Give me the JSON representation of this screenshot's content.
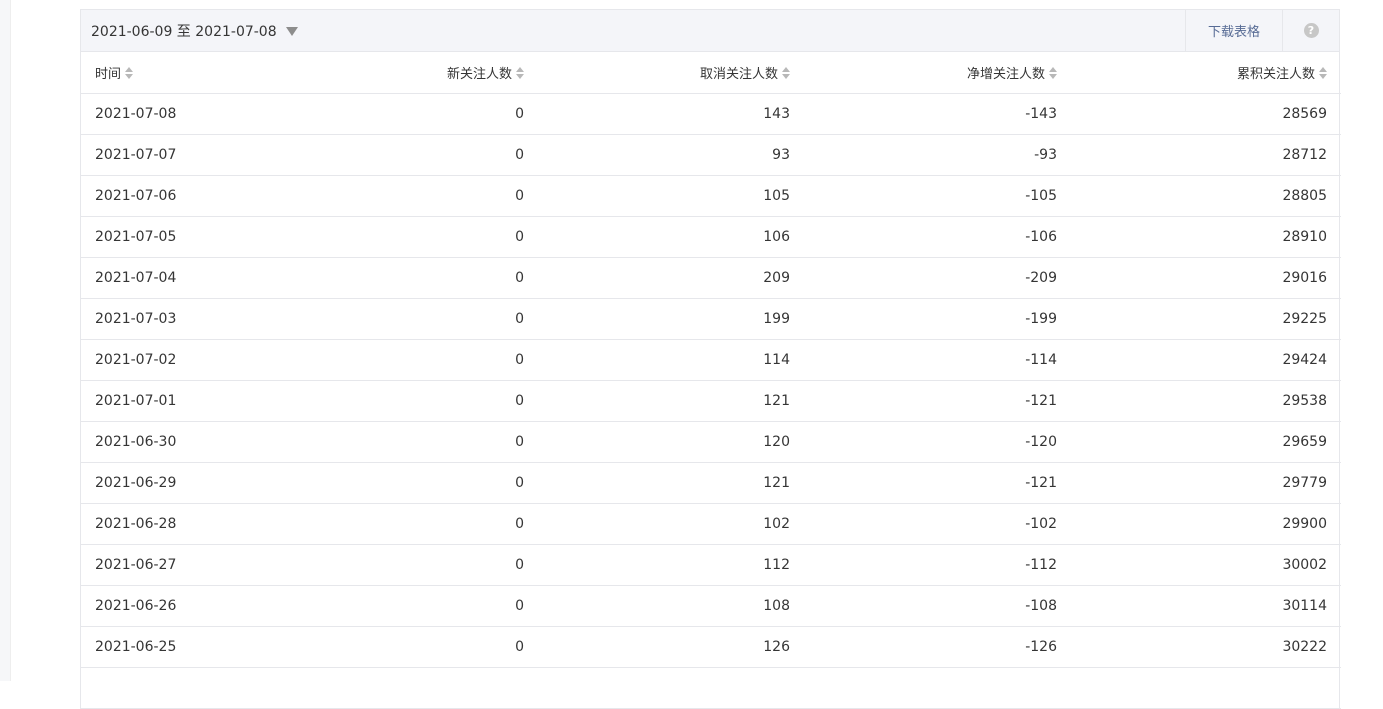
{
  "toolbar": {
    "date_range": "2021-06-09 至 2021-07-08",
    "download_label": "下载表格",
    "help_glyph": "?"
  },
  "table": {
    "headers": [
      "时间",
      "新关注人数",
      "取消关注人数",
      "净增关注人数",
      "累积关注人数"
    ],
    "rows": [
      [
        "2021-07-08",
        "0",
        "143",
        "-143",
        "28569"
      ],
      [
        "2021-07-07",
        "0",
        "93",
        "-93",
        "28712"
      ],
      [
        "2021-07-06",
        "0",
        "105",
        "-105",
        "28805"
      ],
      [
        "2021-07-05",
        "0",
        "106",
        "-106",
        "28910"
      ],
      [
        "2021-07-04",
        "0",
        "209",
        "-209",
        "29016"
      ],
      [
        "2021-07-03",
        "0",
        "199",
        "-199",
        "29225"
      ],
      [
        "2021-07-02",
        "0",
        "114",
        "-114",
        "29424"
      ],
      [
        "2021-07-01",
        "0",
        "121",
        "-121",
        "29538"
      ],
      [
        "2021-06-30",
        "0",
        "120",
        "-120",
        "29659"
      ],
      [
        "2021-06-29",
        "0",
        "121",
        "-121",
        "29779"
      ],
      [
        "2021-06-28",
        "0",
        "102",
        "-102",
        "29900"
      ],
      [
        "2021-06-27",
        "0",
        "112",
        "-112",
        "30002"
      ],
      [
        "2021-06-26",
        "0",
        "108",
        "-108",
        "30114"
      ],
      [
        "2021-06-25",
        "0",
        "126",
        "-126",
        "30222"
      ],
      [
        "",
        "",
        "",
        "",
        ""
      ]
    ]
  },
  "colors": {
    "link": "#576b95",
    "toolbar_bg": "#f4f5f9",
    "border": "#e6e7eb"
  }
}
